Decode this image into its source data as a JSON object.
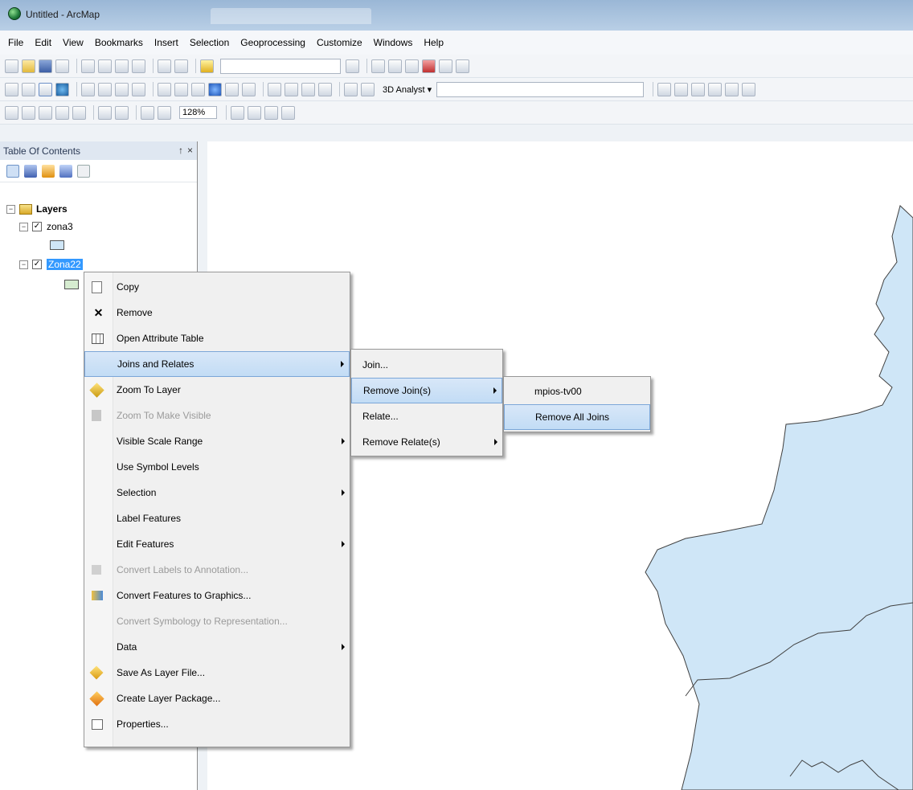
{
  "window": {
    "title": "Untitled - ArcMap"
  },
  "menubar": [
    "File",
    "Edit",
    "View",
    "Bookmarks",
    "Insert",
    "Selection",
    "Geoprocessing",
    "Customize",
    "Windows",
    "Help"
  ],
  "toolbars": {
    "zoom_level": "128%",
    "analyst_label": "3D Analyst ▾"
  },
  "toc": {
    "title": "Table Of Contents",
    "pin": "↑",
    "close": "×",
    "root": "Layers",
    "layers": [
      {
        "name": "zona3",
        "checked": "✓",
        "expander": "−"
      },
      {
        "name": "Zona22",
        "checked": "✓",
        "expander": "−"
      }
    ],
    "root_expander": "−"
  },
  "context_menu": {
    "items": [
      {
        "label": "Copy",
        "icon": "copy-icon"
      },
      {
        "label": "Remove",
        "icon": "remove-icon"
      },
      {
        "label": "Open Attribute Table",
        "icon": "table-icon"
      },
      {
        "label": "Joins and Relates",
        "icon": "",
        "submenu": true,
        "highlighted": true
      },
      {
        "label": "Zoom To Layer",
        "icon": "zoom-layer-icon"
      },
      {
        "label": "Zoom To Make Visible",
        "icon": "zoom-visible-icon",
        "disabled": true
      },
      {
        "label": "Visible Scale Range",
        "icon": "",
        "submenu": true
      },
      {
        "label": "Use Symbol Levels",
        "icon": ""
      },
      {
        "label": "Selection",
        "icon": "",
        "submenu": true
      },
      {
        "label": "Label Features",
        "icon": ""
      },
      {
        "label": "Edit Features",
        "icon": "",
        "submenu": true
      },
      {
        "label": "Convert Labels to Annotation...",
        "icon": "convert-labels-icon",
        "disabled": true
      },
      {
        "label": "Convert Features to Graphics...",
        "icon": "convert-features-icon"
      },
      {
        "label": "Convert Symbology to Representation...",
        "icon": "",
        "disabled": true
      },
      {
        "label": "Data",
        "icon": "",
        "submenu": true
      },
      {
        "label": "Save As Layer File...",
        "icon": "save-layer-icon"
      },
      {
        "label": "Create Layer Package...",
        "icon": "layer-package-icon"
      },
      {
        "label": "Properties...",
        "icon": "properties-icon"
      }
    ]
  },
  "joins_submenu": {
    "items": [
      {
        "label": "Join..."
      },
      {
        "label": "Remove Join(s)",
        "submenu": true,
        "highlighted": true
      },
      {
        "label": "Relate..."
      },
      {
        "label": "Remove Relate(s)",
        "submenu": true
      }
    ]
  },
  "remove_join_submenu": {
    "items": [
      {
        "label": "mpios-tv00"
      },
      {
        "label": "Remove All Joins",
        "highlighted": true
      }
    ]
  },
  "colors": {
    "polygon_fill": "#cfe6f7",
    "polygon_stroke": "#404040",
    "highlight": "#c2dcf5",
    "selection": "#3399ff"
  }
}
